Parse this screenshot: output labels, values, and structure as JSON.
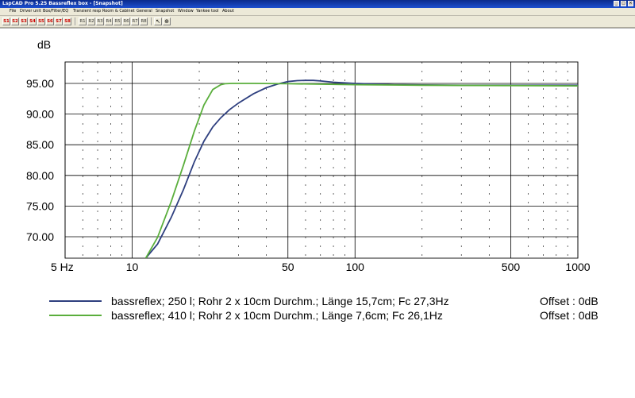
{
  "window": {
    "title": "LspCAD Pro 5.25 Bassreflex box - [Snapshot]",
    "controls": [
      "_",
      "□",
      "×"
    ]
  },
  "menu": {
    "items": [
      "File",
      "Driver unit",
      "Box/Filter/EQ",
      "Transient resp",
      "Room & Cabinet",
      "General",
      "Snapshot",
      "Window",
      "Yankee tool",
      "About"
    ]
  },
  "toolbar": {
    "s_buttons": [
      "S1",
      "S2",
      "S3",
      "S4",
      "S5",
      "S6",
      "S7",
      "S8"
    ],
    "r_buttons": [
      "R1",
      "R2",
      "R3",
      "R4",
      "R5",
      "R6",
      "R7",
      "R8"
    ],
    "tool_icons": [
      "cursor-icon",
      "zoom-icon"
    ]
  },
  "colors": {
    "series1": "#2e3f7f",
    "series2": "#5aae3c",
    "grid": "#000000",
    "text": "#000000",
    "s_button_text": "#cc0000"
  },
  "chart_data": {
    "type": "line",
    "xscale": "log",
    "xlim": [
      5,
      1000
    ],
    "ylim": [
      66.5,
      98.5
    ],
    "ylabel": "dB",
    "xticks": [
      5,
      10,
      50,
      100,
      500,
      1000
    ],
    "xtick_labels": [
      "5 Hz",
      "10",
      "50",
      "100",
      "500",
      "1000"
    ],
    "yticks": [
      70,
      75,
      80,
      85,
      90,
      95
    ],
    "ytick_labels": [
      "70.00",
      "75.00",
      "80.00",
      "85.00",
      "90.00",
      "95.00"
    ],
    "grid": true,
    "legend_position": "bottom",
    "series": [
      {
        "name": "bassreflex; 250 l; Rohr 2 x 10cm Durchm.; Länge 15,7cm; Fc 27,3Hz",
        "offset_label": "Offset : 0dB",
        "color": "#2e3f7f",
        "x": [
          11.5,
          13,
          15,
          17,
          19,
          21,
          23,
          25,
          27.3,
          30,
          35,
          40,
          45,
          50,
          55,
          60,
          65,
          70,
          80,
          100,
          150,
          200,
          300,
          500,
          700,
          1000
        ],
        "y": [
          66.5,
          68.8,
          73.2,
          77.7,
          82.2,
          85.6,
          87.9,
          89.4,
          90.7,
          91.8,
          93.3,
          94.3,
          94.9,
          95.3,
          95.45,
          95.5,
          95.5,
          95.4,
          95.2,
          95.0,
          94.8,
          94.75,
          94.7,
          94.7,
          94.7,
          94.7
        ]
      },
      {
        "name": "bassreflex; 410 l; Rohr 2 x 10cm Durchm.; Länge 7,6cm; Fc 26,1Hz",
        "offset_label": "Offset : 0dB",
        "color": "#5aae3c",
        "x": [
          11.5,
          13,
          15,
          17,
          19,
          21,
          23,
          25,
          26.1,
          28,
          30,
          35,
          50,
          100,
          200,
          500,
          1000
        ],
        "y": [
          66.5,
          69.9,
          75.8,
          81.7,
          87.2,
          91.5,
          94.0,
          94.8,
          94.95,
          95.0,
          95.0,
          95.0,
          94.95,
          94.8,
          94.7,
          94.65,
          94.6
        ]
      }
    ]
  }
}
